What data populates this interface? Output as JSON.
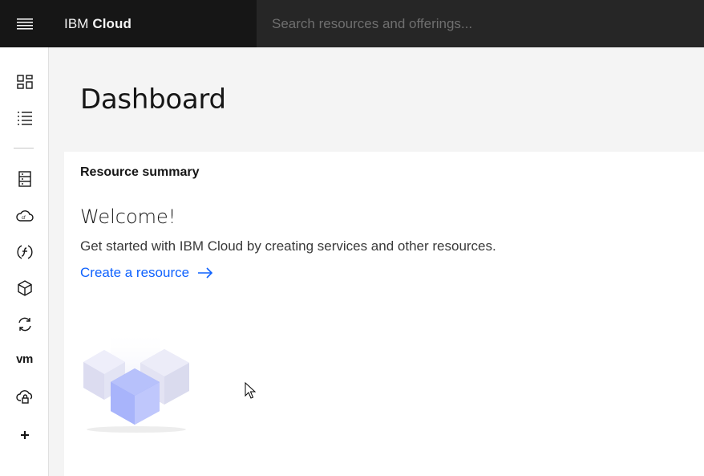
{
  "app": {
    "brand_prefix": "IBM",
    "brand_name": "Cloud"
  },
  "search": {
    "placeholder": "Search resources and offerings..."
  },
  "sidebar": {
    "items": [
      {
        "name": "dashboard",
        "icon": "dashboard-icon"
      },
      {
        "name": "resource-list",
        "icon": "list-icon"
      },
      {
        "name": "classic-infrastructure",
        "icon": "server-icon"
      },
      {
        "name": "cloud-foundry",
        "icon": "cloud-foundry-icon"
      },
      {
        "name": "functions",
        "icon": "functions-icon"
      },
      {
        "name": "kubernetes",
        "icon": "cube-icon"
      },
      {
        "name": "openshift",
        "icon": "sync-icon"
      },
      {
        "name": "vmware",
        "icon": "vm-icon",
        "label": "vm"
      },
      {
        "name": "security",
        "icon": "cloud-lock-icon"
      },
      {
        "name": "add",
        "icon": "plus-icon"
      }
    ]
  },
  "main": {
    "title": "Dashboard",
    "card": {
      "label": "Resource summary",
      "welcome": "Welcome!",
      "description": "Get started with IBM Cloud by creating services and other resources.",
      "link": "Create a resource"
    }
  },
  "colors": {
    "topbar": "#161616",
    "search_bg": "#262626",
    "link": "#0f62fe",
    "page_bg": "#f4f4f4"
  }
}
